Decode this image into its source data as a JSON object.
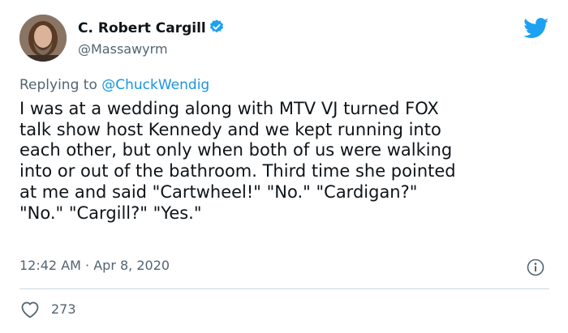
{
  "user": {
    "display_name": "C. Robert Cargill",
    "handle": "@Massawyrm",
    "verified": true
  },
  "reply": {
    "prefix": "Replying to",
    "mention": "@ChuckWendig"
  },
  "tweet": {
    "lines": [
      "I was at a wedding along with MTV VJ turned FOX",
      "talk show host Kennedy and we kept running into",
      "each other, but only when both of us were walking",
      "into or out of the bathroom. Third time she pointed",
      "at me and said \"Cartwheel!\" \"No.\" \"Cardigan?\"",
      "\"No.\" \"Cargill?\" \"Yes.\""
    ],
    "time": "12:42 AM",
    "separator": "·",
    "date": "Apr 8, 2020",
    "likes": "273"
  },
  "icons": {
    "verified": "verified-badge-icon",
    "brand": "twitter-bird-icon",
    "info": "info-icon",
    "like": "heart-icon"
  },
  "colors": {
    "brand": "#1da1f2",
    "mention": "#1b95e0",
    "secondary_text": "#536471",
    "primary_text": "#0f1419"
  }
}
